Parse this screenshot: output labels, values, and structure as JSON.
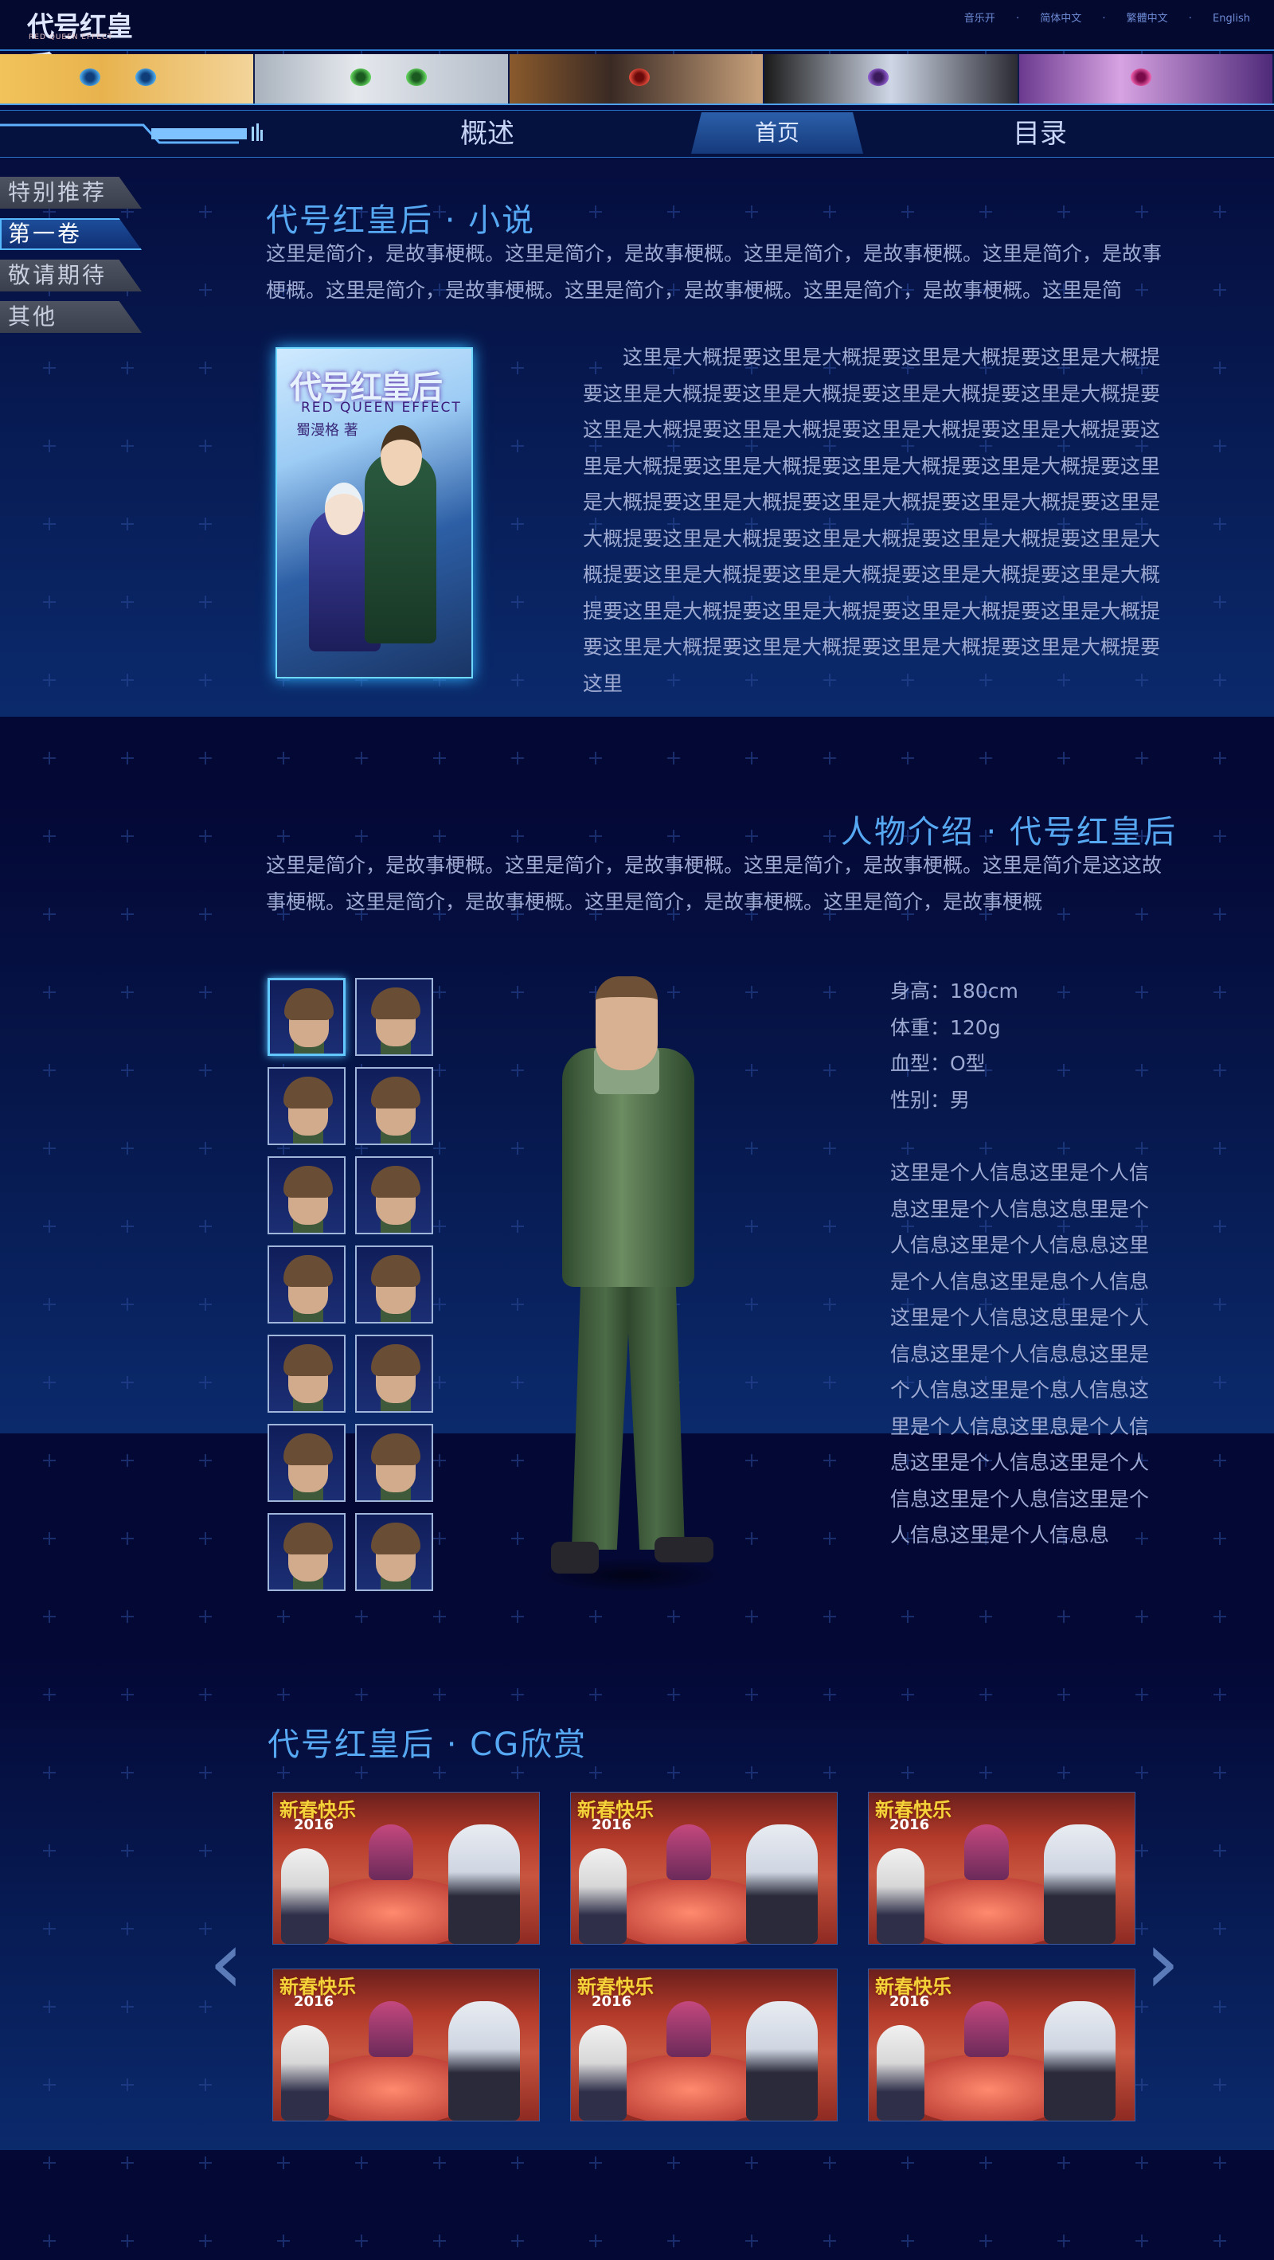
{
  "header": {
    "logo_text": "代号红皇后",
    "logo_sub": "RED QUEEN EFFECT",
    "links": [
      "音乐开",
      "简体中文",
      "繁體中文",
      "English"
    ]
  },
  "nav": {
    "left": "概述",
    "home": "首页",
    "right": "目录"
  },
  "side_menu": [
    {
      "label": "特别推荐",
      "active": false
    },
    {
      "label": "第一卷",
      "active": true
    },
    {
      "label": "敬请期待",
      "active": false
    },
    {
      "label": "其他",
      "active": false
    }
  ],
  "novel": {
    "title": "代号红皇后 · 小说",
    "intro": "这里是简介，是故事梗概。这里是简介，是故事梗概。这里是简介，是故事梗概。这里是简介，是故事梗概。这里是简介，是故事梗概。这里是简介，是故事梗概。这里是简介，是故事梗概。这里是简",
    "book_title": "代号红皇后",
    "book_subtitle": "RED QUEEN EFFECT",
    "book_author": "蜀漫格 著",
    "synopsis": "这里是大概提要这里是大概提要这里是大概提要这里是大概提要这里是大概提要这里是大概提要这里是大概提要这里是大概提要这里是大概提要这里是大概提要这里是大概提要这里是大概提要这里是大概提要这里是大概提要这里是大概提要这里是大概提要这里是大概提要这里是大概提要这里是大概提要这里是大概提要这里是大概提要这里是大概提要这里是大概提要这里是大概提要这里是大概提要这里是大概提要这里是大概提要这里是大概提要这里是大概提要这里是大概提要这里是大概提要这里是大概提要这里是大概提要这里是大概提要这里是大概提要这里是大概提要这里是大概提要这里"
  },
  "characters": {
    "title": "人物介绍 · 代号红皇后",
    "intro": "这里是简介，是故事梗概。这里是简介，是故事梗概。这里是简介，是故事梗概。这里是简介是这这故事梗概。这里是简介，是故事梗概。这里是简介，是故事梗概。这里是简介，是故事梗概",
    "stats": [
      "身高：180cm",
      "体重：120g",
      "血型：O型",
      "性别：男"
    ],
    "bio": "这里是个人信息这里是个人信息这里是个人信息这息里是个人信息这里是个人信息息这里是个人信息这里是息个人信息这里是个人信息这息里是个人信息这里是个人信息息这里是个人信息这里是个息人信息这里是个人信息这里息是个人信息这里是个人信息这里是个人信息这里是个人息信这里是个人信息这里是个人信息息",
    "portrait_count": 14,
    "selected_portrait": 0
  },
  "cg": {
    "title": "代号红皇后 · CG欣赏",
    "image_title": "新春快乐",
    "image_year": "2016",
    "count": 6,
    "prev": "‹",
    "next": "›"
  }
}
